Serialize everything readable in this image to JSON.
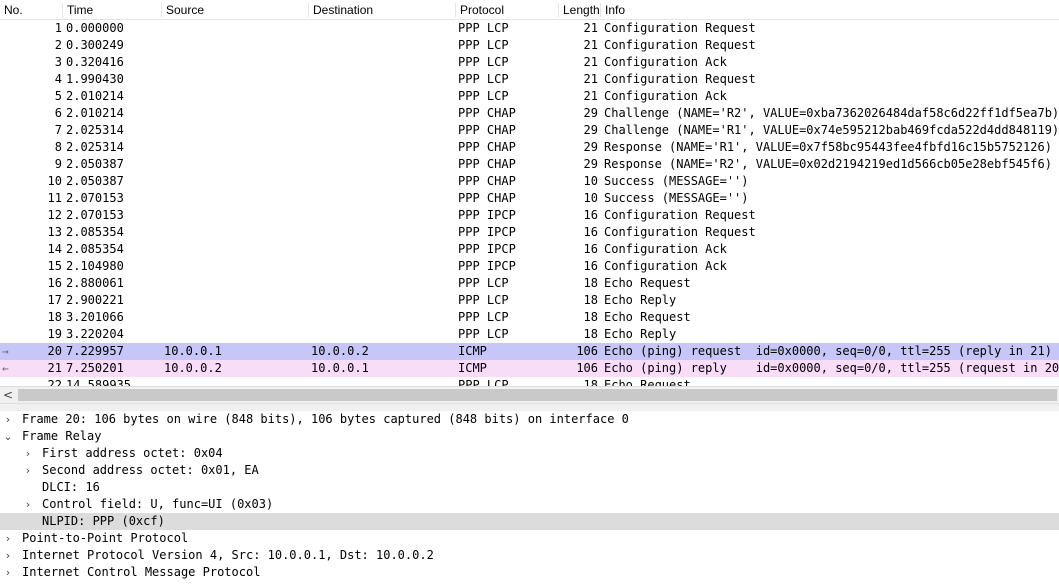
{
  "columns": {
    "no": "No.",
    "time": "Time",
    "source": "Source",
    "destination": "Destination",
    "protocol": "Protocol",
    "length": "Length",
    "info": "Info"
  },
  "packets": [
    {
      "no": "1",
      "time": "0.000000",
      "src": "",
      "dst": "",
      "proto": "PPP LCP",
      "len": "21",
      "info": "Configuration Request"
    },
    {
      "no": "2",
      "time": "0.300249",
      "src": "",
      "dst": "",
      "proto": "PPP LCP",
      "len": "21",
      "info": "Configuration Request"
    },
    {
      "no": "3",
      "time": "0.320416",
      "src": "",
      "dst": "",
      "proto": "PPP LCP",
      "len": "21",
      "info": "Configuration Ack"
    },
    {
      "no": "4",
      "time": "1.990430",
      "src": "",
      "dst": "",
      "proto": "PPP LCP",
      "len": "21",
      "info": "Configuration Request"
    },
    {
      "no": "5",
      "time": "2.010214",
      "src": "",
      "dst": "",
      "proto": "PPP LCP",
      "len": "21",
      "info": "Configuration Ack"
    },
    {
      "no": "6",
      "time": "2.010214",
      "src": "",
      "dst": "",
      "proto": "PPP CHAP",
      "len": "29",
      "info": "Challenge (NAME='R2', VALUE=0xba7362026484daf58c6d22ff1df5ea7b)"
    },
    {
      "no": "7",
      "time": "2.025314",
      "src": "",
      "dst": "",
      "proto": "PPP CHAP",
      "len": "29",
      "info": "Challenge (NAME='R1', VALUE=0x74e595212bab469fcda522d4dd848119)"
    },
    {
      "no": "8",
      "time": "2.025314",
      "src": "",
      "dst": "",
      "proto": "PPP CHAP",
      "len": "29",
      "info": "Response (NAME='R1', VALUE=0x7f58bc95443fee4fbfd16c15b5752126)"
    },
    {
      "no": "9",
      "time": "2.050387",
      "src": "",
      "dst": "",
      "proto": "PPP CHAP",
      "len": "29",
      "info": "Response (NAME='R2', VALUE=0x02d2194219ed1d566cb05e28ebf545f6)"
    },
    {
      "no": "10",
      "time": "2.050387",
      "src": "",
      "dst": "",
      "proto": "PPP CHAP",
      "len": "10",
      "info": "Success (MESSAGE='')"
    },
    {
      "no": "11",
      "time": "2.070153",
      "src": "",
      "dst": "",
      "proto": "PPP CHAP",
      "len": "10",
      "info": "Success (MESSAGE='')"
    },
    {
      "no": "12",
      "time": "2.070153",
      "src": "",
      "dst": "",
      "proto": "PPP IPCP",
      "len": "16",
      "info": "Configuration Request"
    },
    {
      "no": "13",
      "time": "2.085354",
      "src": "",
      "dst": "",
      "proto": "PPP IPCP",
      "len": "16",
      "info": "Configuration Request"
    },
    {
      "no": "14",
      "time": "2.085354",
      "src": "",
      "dst": "",
      "proto": "PPP IPCP",
      "len": "16",
      "info": "Configuration Ack"
    },
    {
      "no": "15",
      "time": "2.104980",
      "src": "",
      "dst": "",
      "proto": "PPP IPCP",
      "len": "16",
      "info": "Configuration Ack"
    },
    {
      "no": "16",
      "time": "2.880061",
      "src": "",
      "dst": "",
      "proto": "PPP LCP",
      "len": "18",
      "info": "Echo Request"
    },
    {
      "no": "17",
      "time": "2.900221",
      "src": "",
      "dst": "",
      "proto": "PPP LCP",
      "len": "18",
      "info": "Echo Reply"
    },
    {
      "no": "18",
      "time": "3.201066",
      "src": "",
      "dst": "",
      "proto": "PPP LCP",
      "len": "18",
      "info": "Echo Request"
    },
    {
      "no": "19",
      "time": "3.220204",
      "src": "",
      "dst": "",
      "proto": "PPP LCP",
      "len": "18",
      "info": "Echo Reply"
    },
    {
      "no": "20",
      "time": "7.229957",
      "src": "10.0.0.1",
      "dst": "10.0.0.2",
      "proto": "ICMP",
      "len": "106",
      "info": "Echo (ping) request  id=0x0000, seq=0/0, ttl=255 (reply in 21)",
      "state": "selected",
      "mark": "→"
    },
    {
      "no": "21",
      "time": "7.250201",
      "src": "10.0.0.2",
      "dst": "10.0.0.1",
      "proto": "ICMP",
      "len": "106",
      "info": "Echo (ping) reply    id=0x0000, seq=0/0, ttl=255 (request in 20)",
      "state": "related",
      "mark": "←"
    },
    {
      "no": "22",
      "time": "14.589935",
      "src": "",
      "dst": "",
      "proto": "PPP LCP",
      "len": "18",
      "info": "Echo Request"
    }
  ],
  "scrollbar": {
    "left_arrow": "<"
  },
  "details": [
    {
      "text": "Frame 20: 106 bytes on wire (848 bits), 106 bytes captured (848 bits) on interface 0",
      "level": 0,
      "toggle": "›"
    },
    {
      "text": "Frame Relay",
      "level": 0,
      "toggle": "⌄"
    },
    {
      "text": "First address octet: 0x04",
      "level": 1,
      "toggle": "›"
    },
    {
      "text": "Second address octet: 0x01, EA",
      "level": 1,
      "toggle": "›"
    },
    {
      "text": "DLCI: 16",
      "level": 1,
      "toggle": ""
    },
    {
      "text": "Control field: U, func=UI (0x03)",
      "level": 1,
      "toggle": "›"
    },
    {
      "text": "NLPID: PPP (0xcf)",
      "level": 1,
      "toggle": "",
      "highlight": true
    },
    {
      "text": "Point-to-Point Protocol",
      "level": 0,
      "toggle": "›"
    },
    {
      "text": "Internet Protocol Version 4, Src: 10.0.0.1, Dst: 10.0.0.2",
      "level": 0,
      "toggle": "›"
    },
    {
      "text": "Internet Control Message Protocol",
      "level": 0,
      "toggle": "›"
    }
  ]
}
